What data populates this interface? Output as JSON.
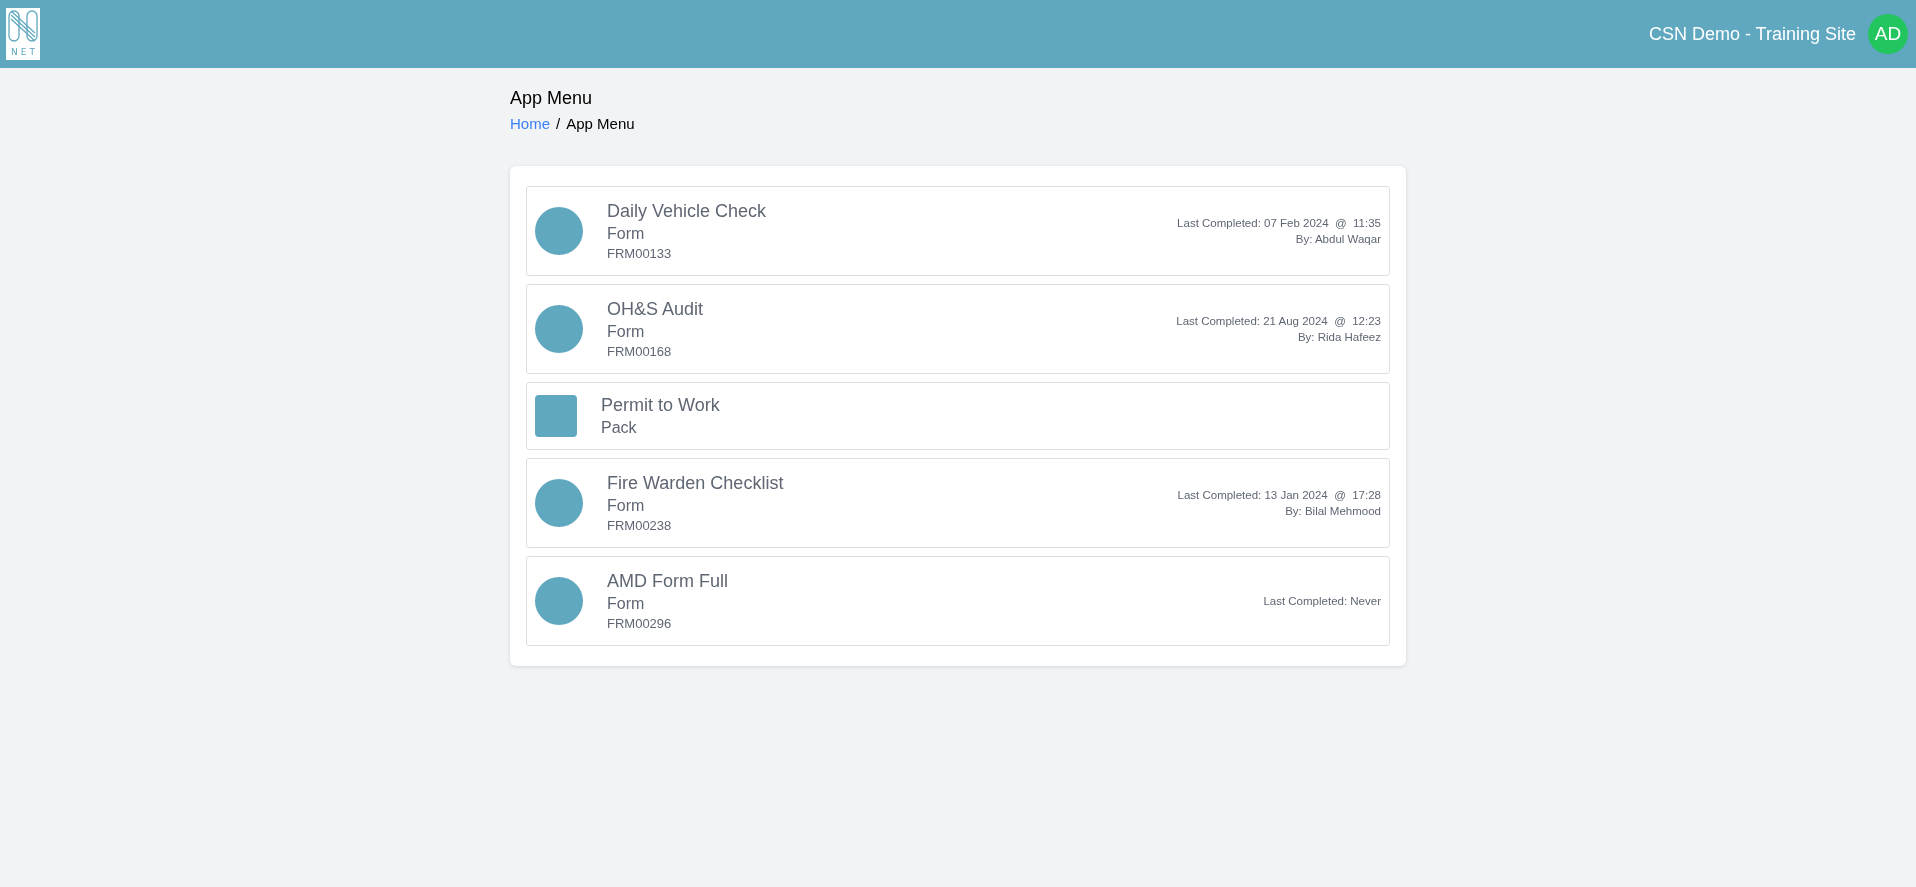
{
  "header": {
    "logo_text": "NET",
    "site_name": "CSN Demo - Training Site",
    "avatar_initials": "AD"
  },
  "page": {
    "title": "App Menu",
    "breadcrumb": [
      {
        "label": "Home",
        "link": true
      },
      {
        "label": "/",
        "link": false
      },
      {
        "label": "App Menu",
        "link": false
      }
    ]
  },
  "items": [
    {
      "kind": "form",
      "title": "Daily Vehicle Check",
      "type": "Form",
      "code": "FRM00133",
      "last_completed": "Last Completed: 07 Feb 2024  @  11:35",
      "by": "By: Abdul Waqar"
    },
    {
      "kind": "form",
      "title": "OH&S Audit",
      "type": "Form",
      "code": "FRM00168",
      "last_completed": "Last Completed: 21 Aug 2024  @  12:23",
      "by": "By: Rida Hafeez"
    },
    {
      "kind": "pack",
      "title": "Permit to Work",
      "type": "Pack"
    },
    {
      "kind": "form",
      "title": "Fire Warden Checklist",
      "type": "Form",
      "code": "FRM00238",
      "last_completed": "Last Completed: 13 Jan 2024  @  17:28",
      "by": "By: Bilal Mehmood"
    },
    {
      "kind": "form",
      "title": "AMD Form Full",
      "type": "Form",
      "code": "FRM00296",
      "last_completed": "Last Completed: Never"
    }
  ]
}
